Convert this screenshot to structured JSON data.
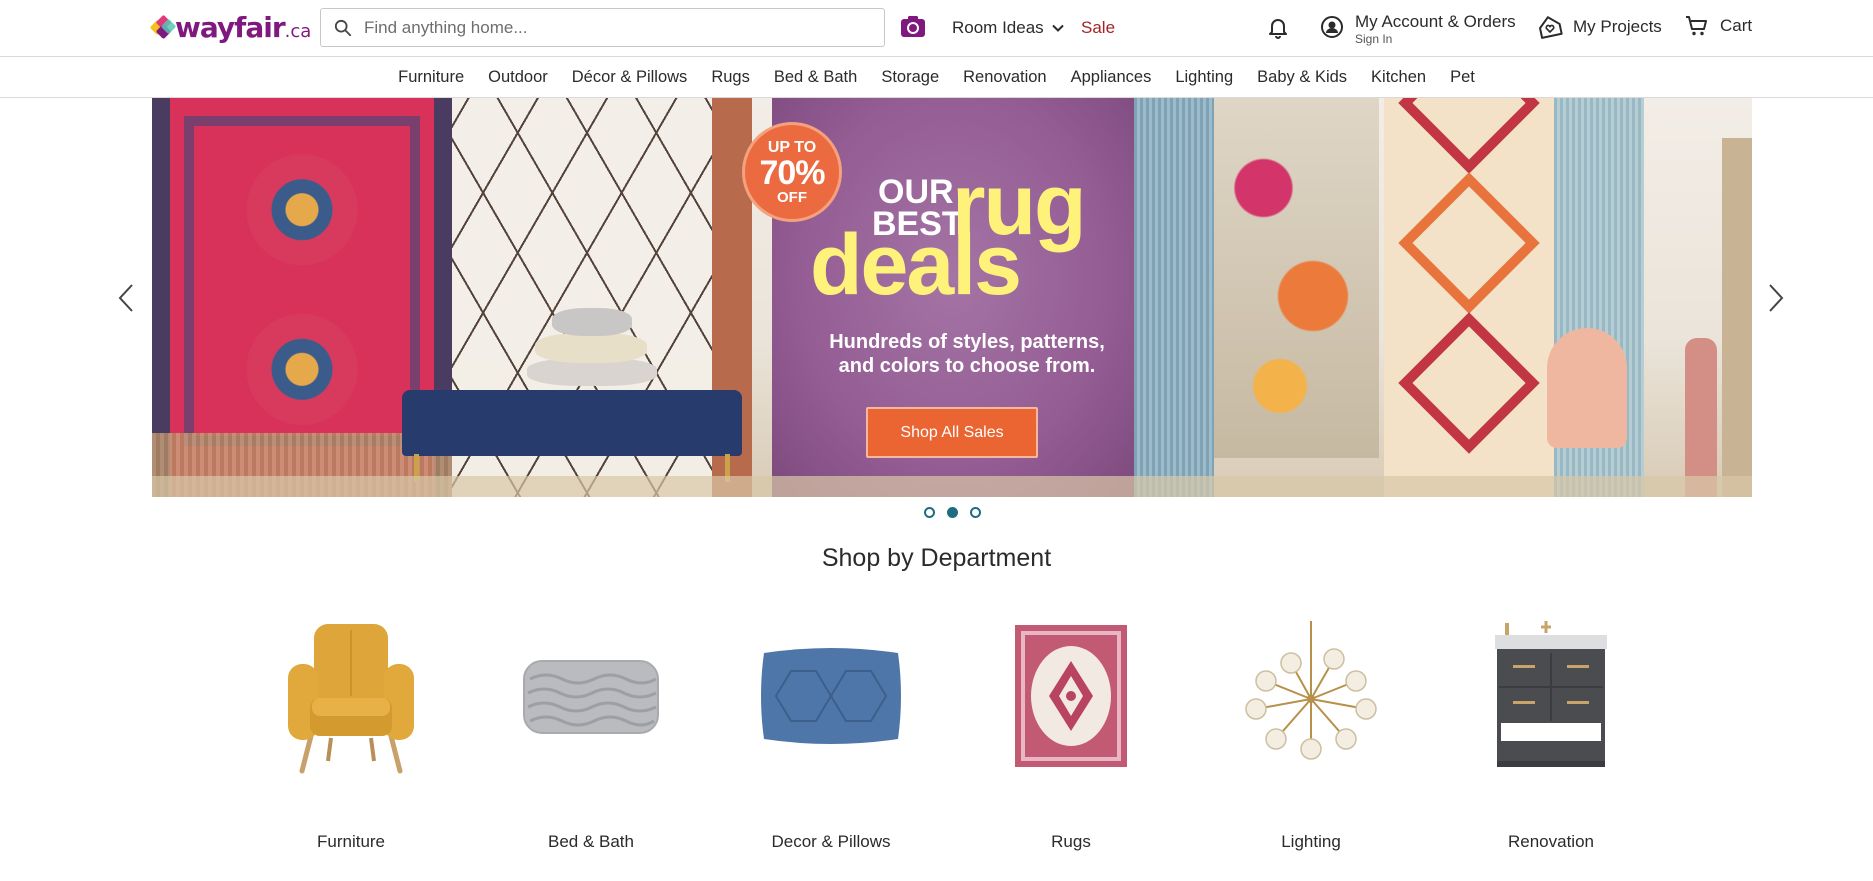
{
  "header": {
    "logo": "wayfair",
    "logo_tld": ".ca",
    "search_placeholder": "Find anything home...",
    "room_ideas": "Room Ideas",
    "sale": "Sale",
    "account_title": "My Account & Orders",
    "account_sub": "Sign In",
    "projects": "My Projects",
    "cart": "Cart"
  },
  "categories": [
    "Furniture",
    "Outdoor",
    "Décor & Pillows",
    "Rugs",
    "Bed & Bath",
    "Storage",
    "Renovation",
    "Appliances",
    "Lighting",
    "Baby & Kids",
    "Kitchen",
    "Pet"
  ],
  "hero": {
    "badge_top": "UP TO",
    "badge_pct": "70%",
    "badge_bottom": "OFF",
    "headline_our": "OUR",
    "headline_best": "BEST",
    "headline_rug": "rug",
    "headline_deals": "deals",
    "subtitle": "Hundreds of styles, patterns, and colors to choose from.",
    "cta": "Shop All Sales",
    "slide_count": 3,
    "active_slide": 2
  },
  "section_title": "Shop by Department",
  "departments": [
    {
      "label": "Furniture",
      "icon": "armchair-icon"
    },
    {
      "label": "Bed & Bath",
      "icon": "throw-blanket-icon"
    },
    {
      "label": "Decor & Pillows",
      "icon": "pillow-icon"
    },
    {
      "label": "Rugs",
      "icon": "rug-icon"
    },
    {
      "label": "Lighting",
      "icon": "chandelier-icon"
    },
    {
      "label": "Renovation",
      "icon": "vanity-icon"
    }
  ],
  "colors": {
    "brand_purple": "#7f187f",
    "sale_red": "#a3232b",
    "cta_orange": "#ea6532",
    "dot_teal": "#1f6d81"
  }
}
